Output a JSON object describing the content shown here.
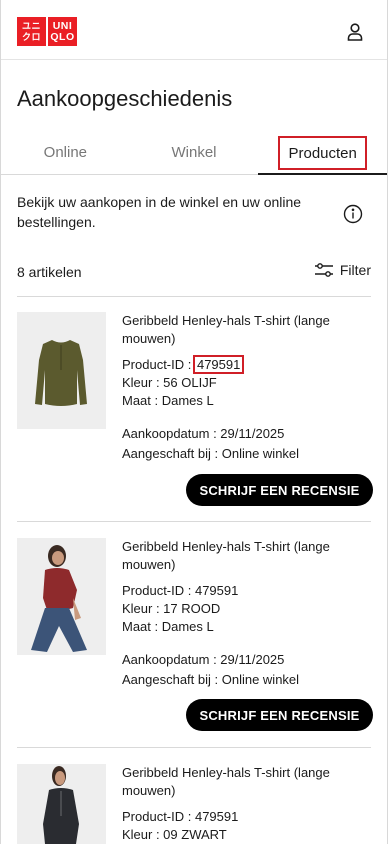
{
  "header": {
    "logo_line1": "UNI",
    "logo_line2": "QLO",
    "logo_kanji_line1": "ユニ",
    "logo_kanji_line2": "クロ",
    "account_icon": "user-icon"
  },
  "page": {
    "title": "Aankoopgeschiedenis"
  },
  "tabs": [
    {
      "label": "Online"
    },
    {
      "label": "Winkel"
    },
    {
      "label": "Producten",
      "active": true
    }
  ],
  "intro": {
    "text": "Bekijk uw aankopen in de winkel en uw online bestellingen.",
    "info_icon": "info-icon"
  },
  "list": {
    "count": "8 artikelen",
    "filter_label": "Filter",
    "filter_icon": "sliders-icon"
  },
  "items": [
    {
      "name": "Geribbeld Henley-hals T-shirt (lange mouwen)",
      "product_id_label": "Product-ID : ",
      "product_id": "479591",
      "color": "Kleur : 56 OLIJF",
      "size": "Maat : Dames L",
      "purchase_date": "Aankoopdatum : 29/11/2025",
      "purchased_at": "Aangeschaft bij : Online winkel",
      "button": "SCHRIJF EEN RECENSIE",
      "shirt_color": "#5b5a2e"
    },
    {
      "name": "Geribbeld Henley-hals T-shirt (lange mouwen)",
      "product_id_label": "Product-ID : ",
      "product_id": "479591",
      "color": "Kleur : 17 ROOD",
      "size": "Maat : Dames L",
      "purchase_date": "Aankoopdatum : 29/11/2025",
      "purchased_at": "Aangeschaft bij : Online winkel",
      "button": "SCHRIJF EEN RECENSIE",
      "shirt_color": "#8e2a2c"
    },
    {
      "name": "Geribbeld Henley-hals T-shirt (lange mouwen)",
      "product_id_label": "Product-ID : ",
      "product_id": "479591",
      "color": "Kleur : 09 ZWART",
      "shirt_color": "#2a2c31"
    }
  ],
  "colors": {
    "brand_red": "#ea1f25",
    "highlight_red": "#d01f27",
    "button_black": "#000000"
  }
}
